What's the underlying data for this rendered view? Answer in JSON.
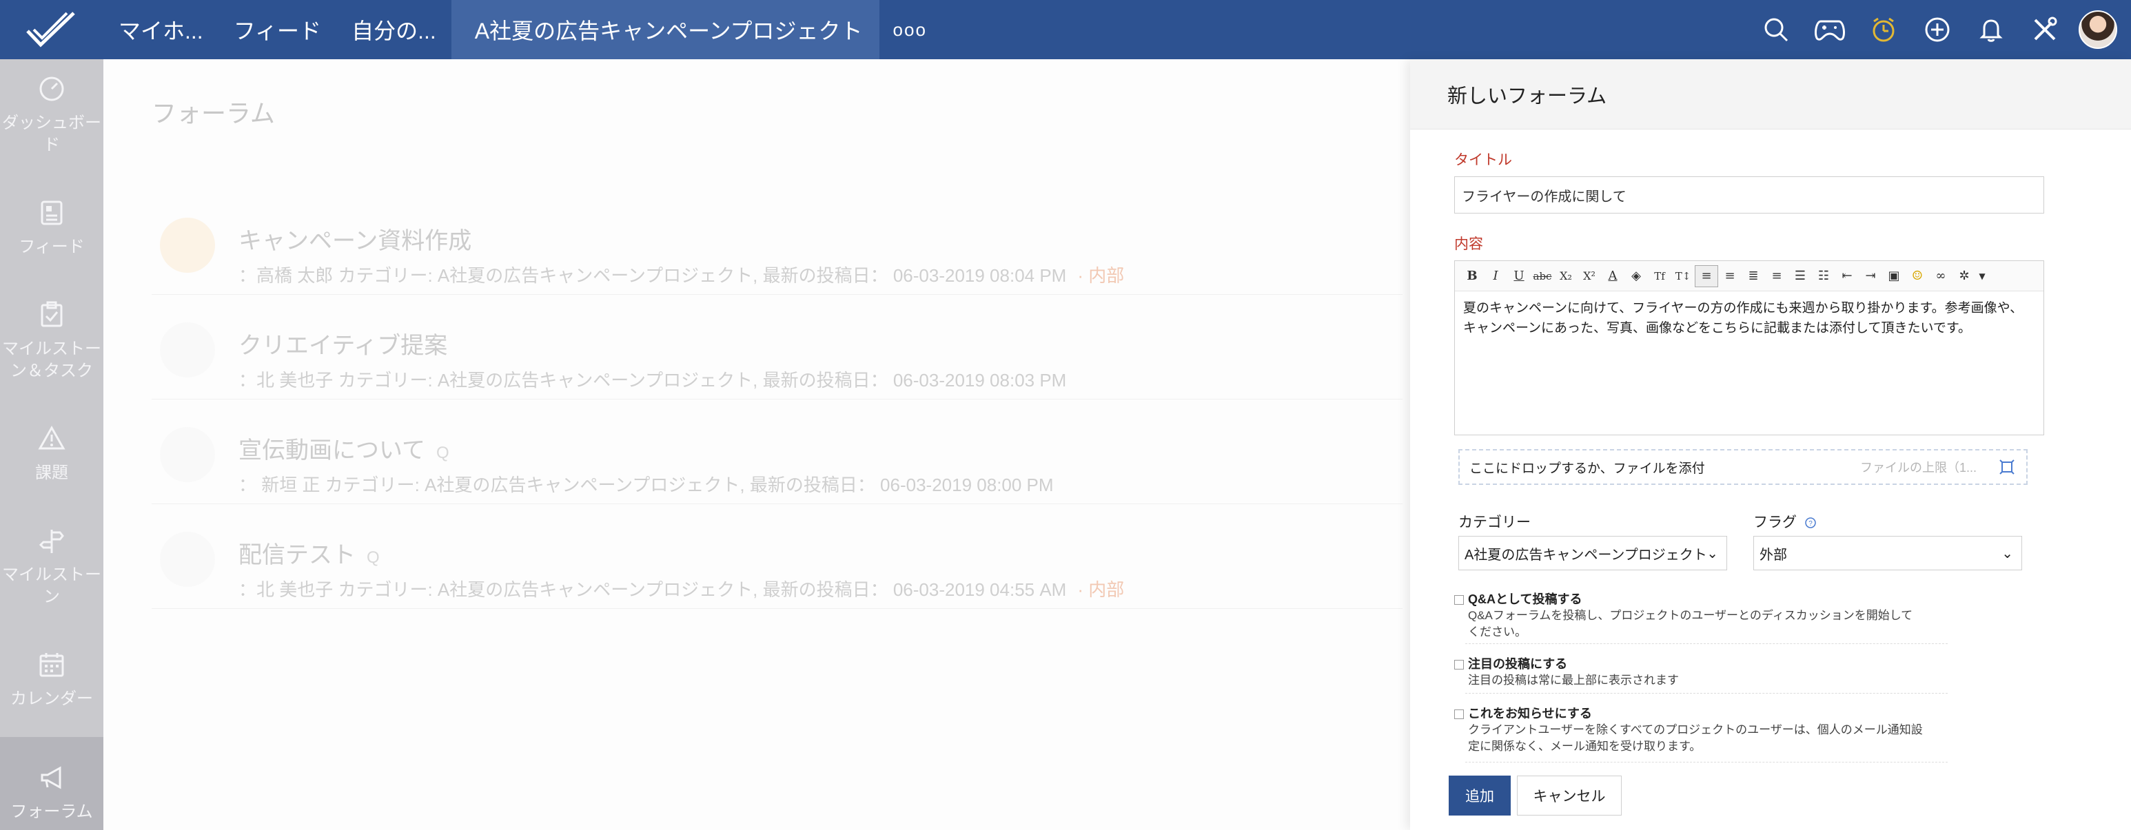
{
  "topbar": {
    "nav": [
      "マイホ...",
      "フィード",
      "自分の..."
    ],
    "project": "A社夏の広告キャンペーンプロジェクト",
    "more": "ooo",
    "icons": [
      "search-icon",
      "gamepad-icon",
      "timer-icon",
      "add-icon",
      "bell-icon",
      "tools-icon"
    ]
  },
  "sidebar": {
    "items": [
      {
        "label": "ダッシュボード",
        "icon": "dashboard-icon"
      },
      {
        "label": "フィード",
        "icon": "feed-icon"
      },
      {
        "label": "マイルストーン＆タスク",
        "icon": "task-icon"
      },
      {
        "label": "課題",
        "icon": "warning-icon"
      },
      {
        "label": "マイルストーン",
        "icon": "signpost-icon"
      },
      {
        "label": "カレンダー",
        "icon": "calendar-icon"
      },
      {
        "label": "フォーラム",
        "icon": "megaphone-icon"
      }
    ]
  },
  "main": {
    "title": "フォーラム",
    "forums": [
      {
        "title": "キャンペーン資料作成",
        "meta": "：高橋 太郎  カテゴリー: A社夏の広告キャンペーンプロジェクト,  最新の投稿日：  06-03-2019 08:04 PM",
        "tag": "· 内部",
        "q": ""
      },
      {
        "title": "クリエイティブ提案",
        "meta": "：北 美也子 カテゴリー: A社夏の広告キャンペーンプロジェクト,  最新の投稿日：  06-03-2019 08:03 PM",
        "tag": "",
        "q": ""
      },
      {
        "title": "宣伝動画について",
        "meta": "：  新垣 正   カテゴリー: A社夏の広告キャンペーンプロジェクト,  最新の投稿日：  06-03-2019 08:00 PM",
        "tag": "",
        "q": "Q"
      },
      {
        "title": "配信テスト",
        "meta": "：北 美也子 カテゴリー: A社夏の広告キャンペーンプロジェクト,  最新の投稿日：  06-03-2019 04:55 AM",
        "tag": "· 内部",
        "q": "Q"
      }
    ]
  },
  "panel": {
    "header": "新しいフォーラム",
    "title_label": "タイトル",
    "title_value": "フライヤーの作成に関して",
    "content_label": "内容",
    "content_text": "夏のキャンペーンに向けて、フライヤーの方の作成にも来週から取り掛かります。参考画像や、キャンペーンにあった、写真、画像などをこちらに記載または添付して頂きたいです。",
    "dropzone": "ここにドロップするか、ファイルを添付",
    "file_hint": "ファイルの上限（1...",
    "category_label": "カテゴリー",
    "category_value": "A社夏の広告キャンペーンプロジェクト",
    "flag_label": "フラグ",
    "flag_value": "外部",
    "options": [
      {
        "title": "Q&Aとして投稿する",
        "desc": "Q&Aフォーラムを投稿し、プロジェクトのユーザーとのディスカッションを開始してください。"
      },
      {
        "title": "注目の投稿にする",
        "desc": "注目の投稿は常に最上部に表示されます"
      },
      {
        "title": "これをお知らせにする",
        "desc": "クライアントユーザーを除くすべてのプロジェクトのユーザーは、個人のメール通知設定に関係なく、メール通知を受け取ります。"
      }
    ],
    "add": "追加",
    "cancel": "キャンセル"
  },
  "colors": {
    "brand": "#2d5291",
    "required": "#c0392b"
  }
}
